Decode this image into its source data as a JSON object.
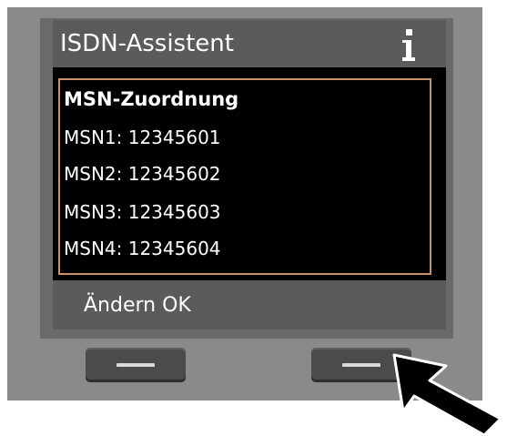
{
  "header": {
    "title": "ISDN-Assistent",
    "info_icon": "info-icon"
  },
  "panel": {
    "heading": "MSN-Zuordnung",
    "rows": [
      "MSN1: 12345601",
      "MSN2: 12345602",
      "MSN3: 12345603",
      "MSN4: 12345604"
    ]
  },
  "softkeys": {
    "label": "Ändern OK"
  },
  "colors": {
    "device": "#8a8a8a",
    "screen_bar": "#5b5b5b",
    "panel_border": "#c8916b",
    "arrow": "#000000"
  },
  "icons": {
    "pointer": "pointer-arrow-icon"
  }
}
